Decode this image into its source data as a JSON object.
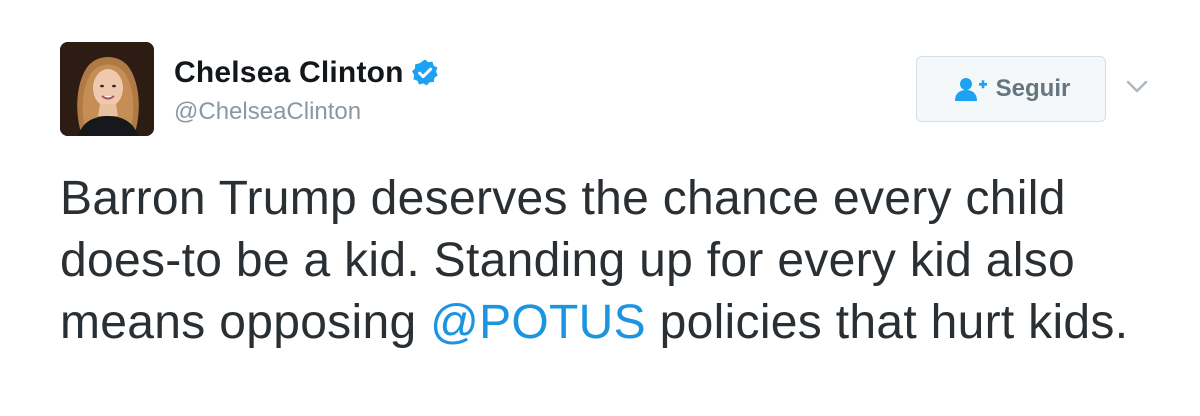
{
  "author": {
    "display_name": "Chelsea Clinton",
    "handle": "@ChelseaClinton",
    "verified": true,
    "avatar": "profile-photo"
  },
  "follow_button": {
    "label": "Seguir",
    "icon": "add-user-icon"
  },
  "menu": {
    "icon": "chevron-down-icon"
  },
  "tweet": {
    "text_before": "Barron Trump deserves the chance every child does-to be a kid. Standing up for every kid also means opposing ",
    "mention": "@POTUS",
    "text_after": " policies that hurt kids."
  },
  "colors": {
    "verified_blue": "#1da1f2",
    "mention_blue": "#1b95e0",
    "handle_gray": "#8899a6",
    "button_text": "#66757f"
  }
}
